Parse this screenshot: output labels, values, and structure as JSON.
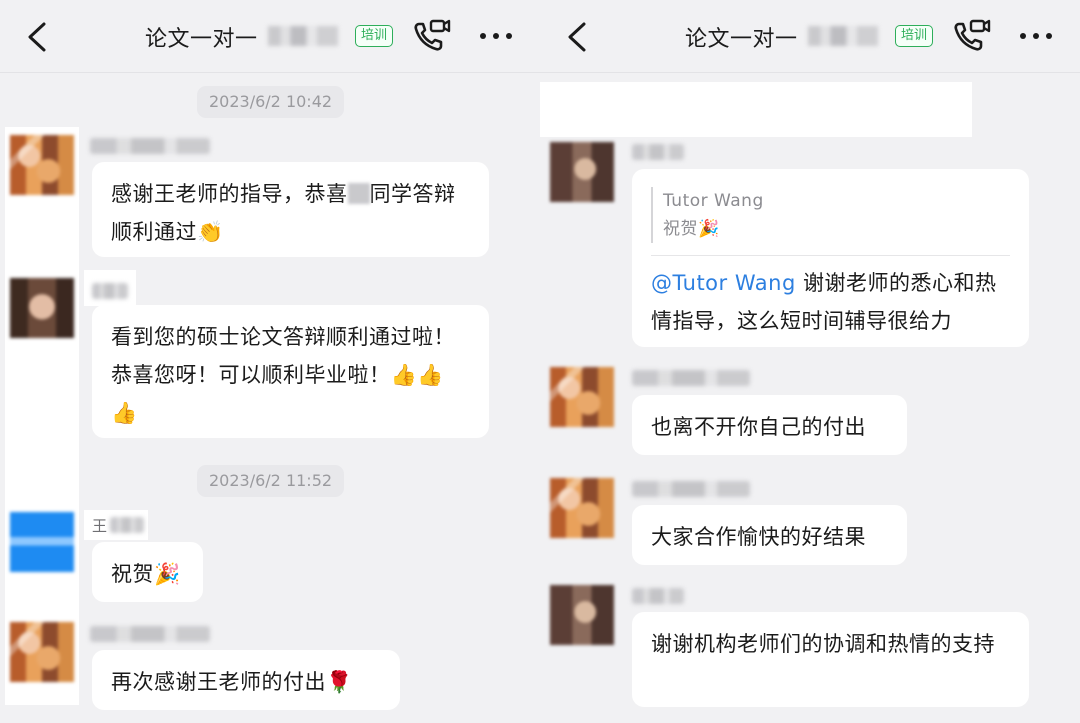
{
  "chat_title": "论文一对一",
  "badge": "培训",
  "left": {
    "timestamp_1": "2023/6/2 10:42",
    "msg1": {
      "before": "感谢王老师的指导，恭喜",
      "after": "同学答辩顺利通过",
      "emoji": "👏"
    },
    "msg2": {
      "text": "看到您的硕士论文答辩顺利通过啦！恭喜您呀！可以顺利毕业啦！",
      "emoji": "👍👍👍"
    },
    "timestamp_2": "2023/6/2 11:52",
    "sender_wang": "王",
    "msg3": {
      "text": "祝贺",
      "emoji": "🎉"
    },
    "msg4": {
      "text": "再次感谢王老师的付出",
      "emoji": "🌹"
    }
  },
  "right": {
    "quote": {
      "name": "Tutor Wang",
      "text": "祝贺",
      "emoji": "🎉"
    },
    "msg1": {
      "mention": "@Tutor Wang",
      "text": " 谢谢老师的悉心和热情指导，这么短时间辅导很给力"
    },
    "msg2": "也离不开你自己的付出",
    "msg3": "大家合作愉快的好结果",
    "msg4": "谢谢机构老师们的协调和热情的支持"
  },
  "colors": {
    "background": "#f1f1f3",
    "bubble": "#ffffff",
    "badge_green": "#2eae5a",
    "mention_blue": "#2d7fe0",
    "timestamp_bg": "#e8e8eb"
  },
  "icons": [
    "back-arrow-icon",
    "phone-video-call-icon",
    "more-dots-icon"
  ]
}
